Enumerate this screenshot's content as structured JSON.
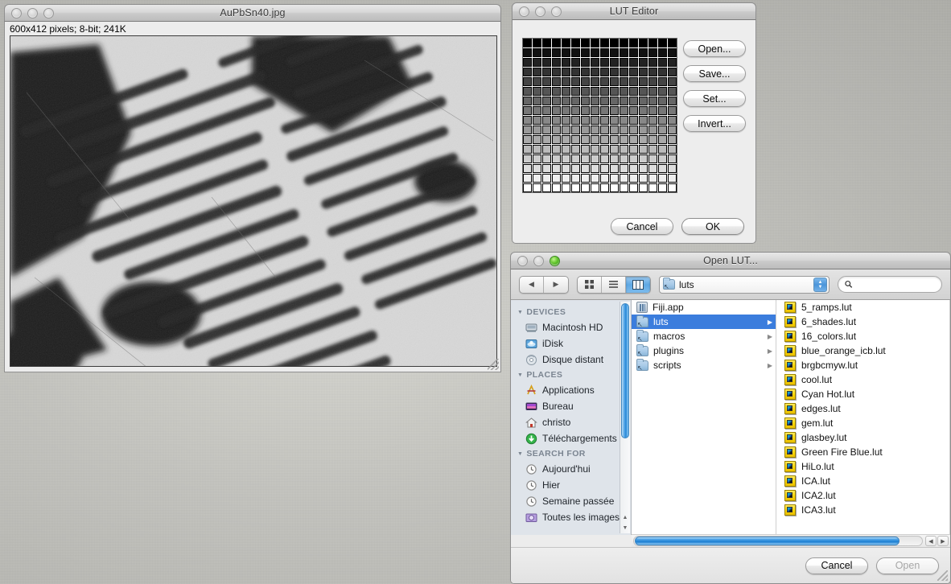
{
  "desktop": {
    "background_color": "#c2c2bd"
  },
  "image_window": {
    "title": "AuPbSn40.jpg",
    "info": "600x412 pixels; 8-bit; 241K",
    "canvas_description": "grayscale metallographic micrograph of AuPbSn40 lamellar eutectic microstructure"
  },
  "lut_editor": {
    "title": "LUT Editor",
    "grid": {
      "columns": 16,
      "rows": 16,
      "ramp": "black-to-white grayscale by row"
    },
    "buttons": {
      "open": "Open...",
      "save": "Save...",
      "set": "Set...",
      "invert": "Invert...",
      "cancel": "Cancel",
      "ok": "OK"
    }
  },
  "open_lut": {
    "title": "Open LUT...",
    "toolbar": {
      "back_icon": "triangle-left-icon",
      "forward_icon": "triangle-right-icon",
      "view_icon_mode": "grid-view-icon",
      "view_list_mode": "list-view-icon",
      "view_column_mode": "column-view-icon",
      "active_view": "column",
      "path_label": "luts",
      "search_placeholder": "",
      "search_value": ""
    },
    "sidebar": {
      "sections": [
        {
          "header": "DEVICES",
          "items": [
            {
              "label": "Macintosh HD",
              "icon": "hard-disk-icon"
            },
            {
              "label": "iDisk",
              "icon": "idisk-icon"
            },
            {
              "label": "Disque distant",
              "icon": "remote-disc-icon"
            }
          ]
        },
        {
          "header": "PLACES",
          "items": [
            {
              "label": "Applications",
              "icon": "applications-icon"
            },
            {
              "label": "Bureau",
              "icon": "desktop-icon"
            },
            {
              "label": "christo",
              "icon": "home-icon"
            },
            {
              "label": "Téléchargements",
              "icon": "downloads-icon"
            }
          ]
        },
        {
          "header": "SEARCH FOR",
          "items": [
            {
              "label": "Aujourd'hui",
              "icon": "clock-icon"
            },
            {
              "label": "Hier",
              "icon": "clock-icon"
            },
            {
              "label": "Semaine passée",
              "icon": "clock-icon"
            },
            {
              "label": "Toutes les images",
              "icon": "images-search-icon"
            }
          ]
        }
      ]
    },
    "column_one": [
      {
        "label": "Fiji.app",
        "icon": "app-icon",
        "has_children": false,
        "selected": false
      },
      {
        "label": "luts",
        "icon": "folder-alias-icon",
        "has_children": true,
        "selected": true
      },
      {
        "label": "macros",
        "icon": "folder-alias-icon",
        "has_children": true,
        "selected": false
      },
      {
        "label": "plugins",
        "icon": "folder-alias-icon",
        "has_children": true,
        "selected": false
      },
      {
        "label": "scripts",
        "icon": "folder-alias-icon",
        "has_children": true,
        "selected": false
      }
    ],
    "column_two": [
      "5_ramps.lut",
      "6_shades.lut",
      "16_colors.lut",
      "blue_orange_icb.lut",
      "brgbcmyw.lut",
      "cool.lut",
      "Cyan Hot.lut",
      "edges.lut",
      "gem.lut",
      "glasbey.lut",
      "Green Fire Blue.lut",
      "HiLo.lut",
      "ICA.lut",
      "ICA2.lut",
      "ICA3.lut"
    ],
    "footer": {
      "cancel": "Cancel",
      "open": "Open",
      "open_disabled": true
    }
  }
}
